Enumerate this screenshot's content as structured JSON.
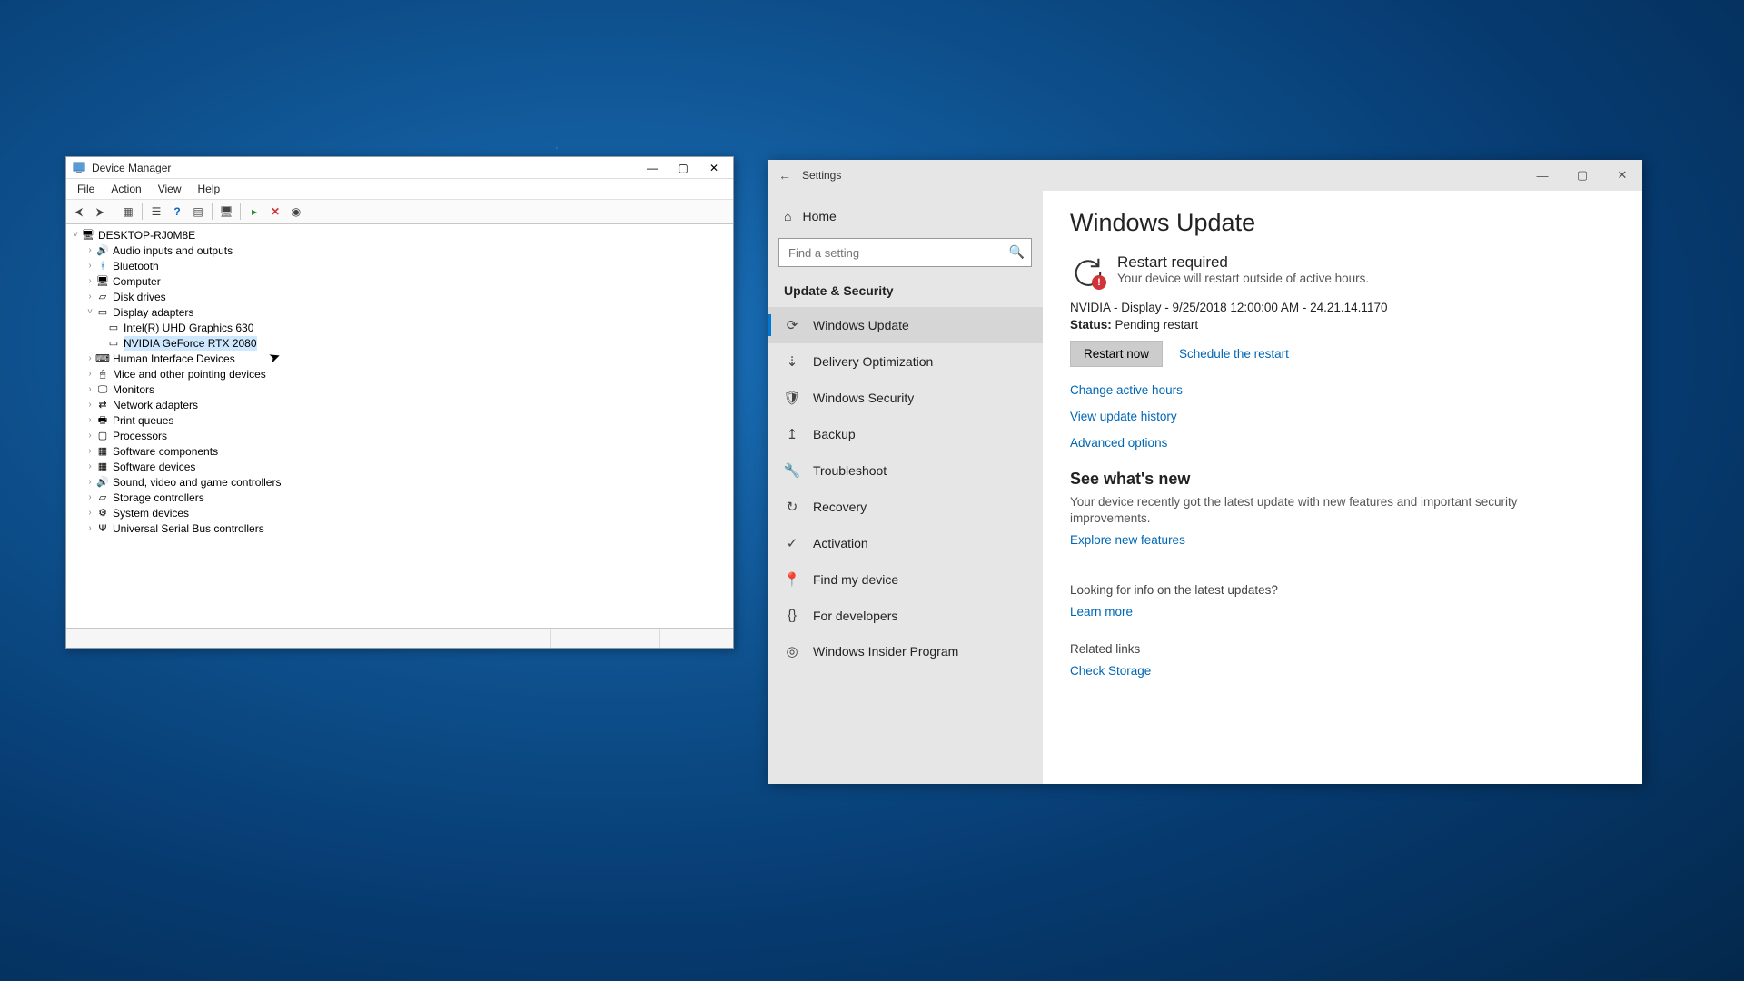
{
  "device_manager": {
    "title": "Device Manager",
    "menu": {
      "file": "File",
      "action": "Action",
      "view": "View",
      "help": "Help"
    },
    "root": "DESKTOP-RJ0M8E",
    "nodes": {
      "audio": "Audio inputs and outputs",
      "bluetooth": "Bluetooth",
      "computer": "Computer",
      "disk": "Disk drives",
      "display": "Display adapters",
      "display_children": {
        "intel": "Intel(R) UHD Graphics 630",
        "nvidia": "NVIDIA GeForce RTX 2080"
      },
      "hid": "Human Interface Devices",
      "mice": "Mice and other pointing devices",
      "monitors": "Monitors",
      "network": "Network adapters",
      "print": "Print queues",
      "processors": "Processors",
      "softcomp": "Software components",
      "softdev": "Software devices",
      "sound": "Sound, video and game controllers",
      "storage": "Storage controllers",
      "system": "System devices",
      "usb": "Universal Serial Bus controllers"
    }
  },
  "settings": {
    "title": "Settings",
    "home": "Home",
    "search_placeholder": "Find a setting",
    "category": "Update & Security",
    "nav": {
      "windows_update": "Windows Update",
      "delivery": "Delivery Optimization",
      "security": "Windows Security",
      "backup": "Backup",
      "troubleshoot": "Troubleshoot",
      "recovery": "Recovery",
      "activation": "Activation",
      "find": "Find my device",
      "developers": "For developers",
      "insider": "Windows Insider Program"
    },
    "page": {
      "heading": "Windows Update",
      "restart_title": "Restart required",
      "restart_sub": "Your device will restart outside of active hours.",
      "update_line": "NVIDIA - Display - 9/25/2018 12:00:00 AM - 24.21.14.1170",
      "status_label": "Status:",
      "status_value": " Pending restart",
      "restart_now": "Restart now",
      "schedule": "Schedule the restart",
      "change_hours": "Change active hours",
      "view_history": "View update history",
      "advanced": "Advanced options",
      "whatsnew_h": "See what's new",
      "whatsnew_p": "Your device recently got the latest update with new features and important security improvements.",
      "explore": "Explore new features",
      "looking": "Looking for info on the latest updates?",
      "learn_more": "Learn more",
      "related": "Related links",
      "check_storage": "Check Storage"
    }
  }
}
